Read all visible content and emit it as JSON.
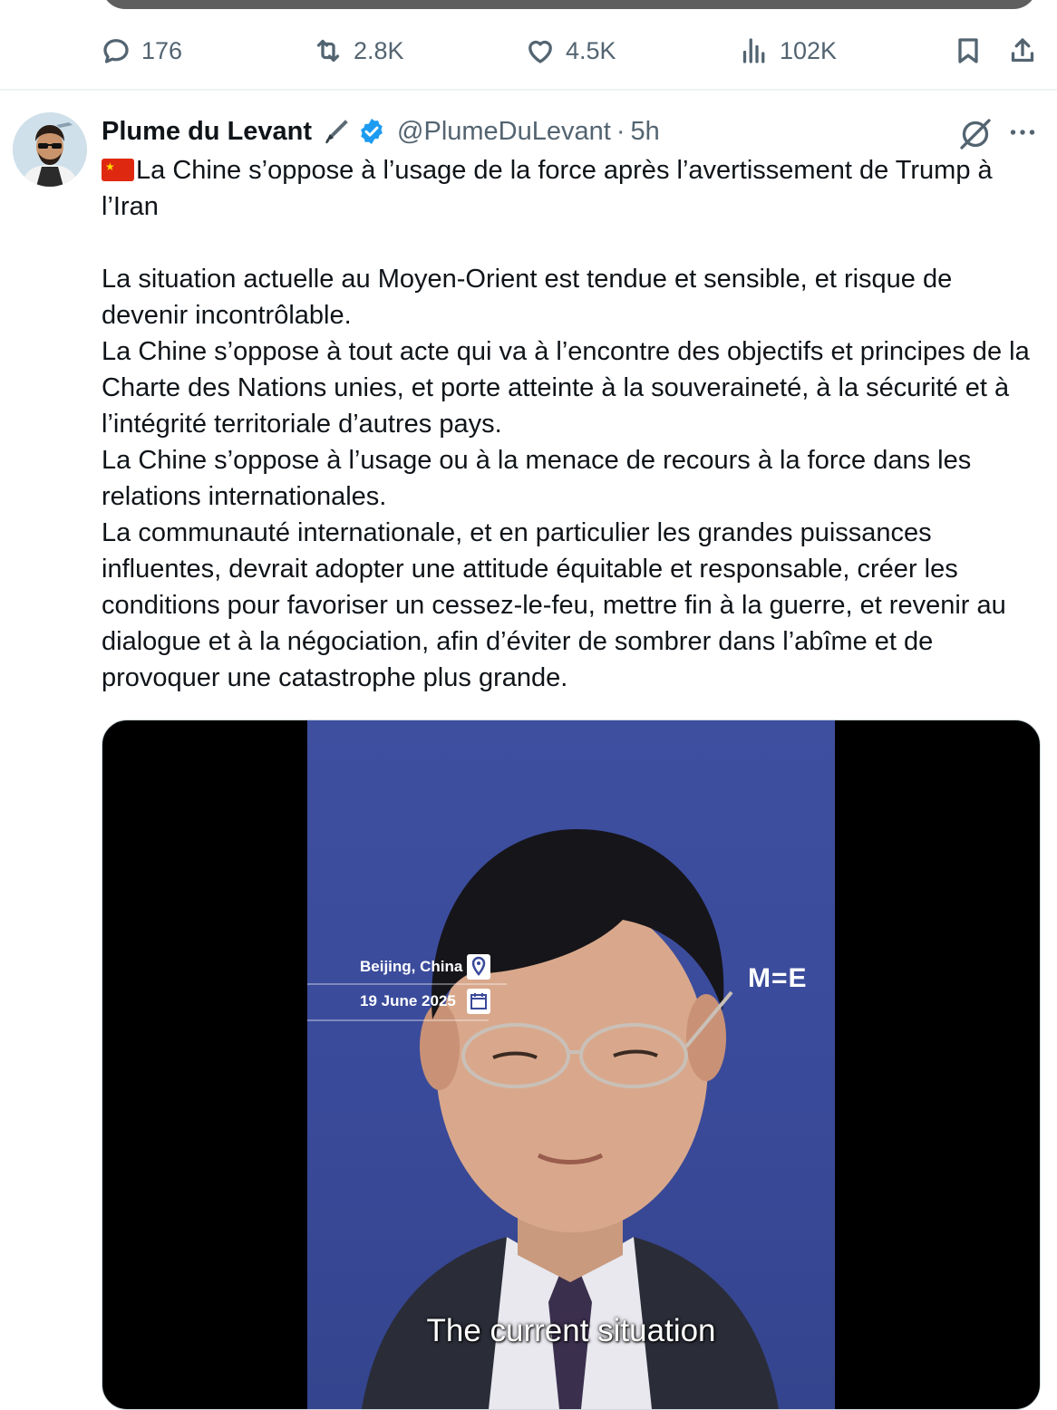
{
  "previous_tweet": {
    "actions": {
      "replies": "176",
      "reposts": "2.8K",
      "likes": "4.5K",
      "views": "102K"
    }
  },
  "tweet": {
    "author_name": "Plume du Levant",
    "handle": "@PlumeDuLevant",
    "separator": "·",
    "time": "5h",
    "flag_emoji": "🇨🇳",
    "paragraphs": [
      "La Chine s’oppose à l’usage de la force après l’avertissement de Trump à l’Iran",
      "",
      "La situation actuelle au Moyen-Orient est tendue et sensible, et risque de devenir incontrôlable.",
      "La Chine s’oppose à tout acte qui va à l’encontre des objectifs et principes de la Charte des Nations unies, et porte atteinte à la souveraineté, à la sécurité et à l’intégrité territoriale d’autres pays.",
      "La Chine s’oppose à l’usage ou à la menace de recours à la force dans les relations internationales.",
      "La communauté internationale, et en particulier les grandes puissances influentes, devrait adopter une attitude équitable et responsable, créer les conditions pour favoriser un cessez-le-feu, mettre fin à la guerre, et revenir au dialogue et à la négociation, afin d’éviter de sombrer dans l’abîme et de provoquer une catastrophe plus grande."
    ],
    "video": {
      "location": "Beijing, China",
      "date": "19 June 2025",
      "logo": "M=E",
      "subtitle": "The current situation"
    }
  },
  "colors": {
    "muted": "#536471",
    "verified": "#1d9bf0",
    "text": "#0f1419"
  }
}
